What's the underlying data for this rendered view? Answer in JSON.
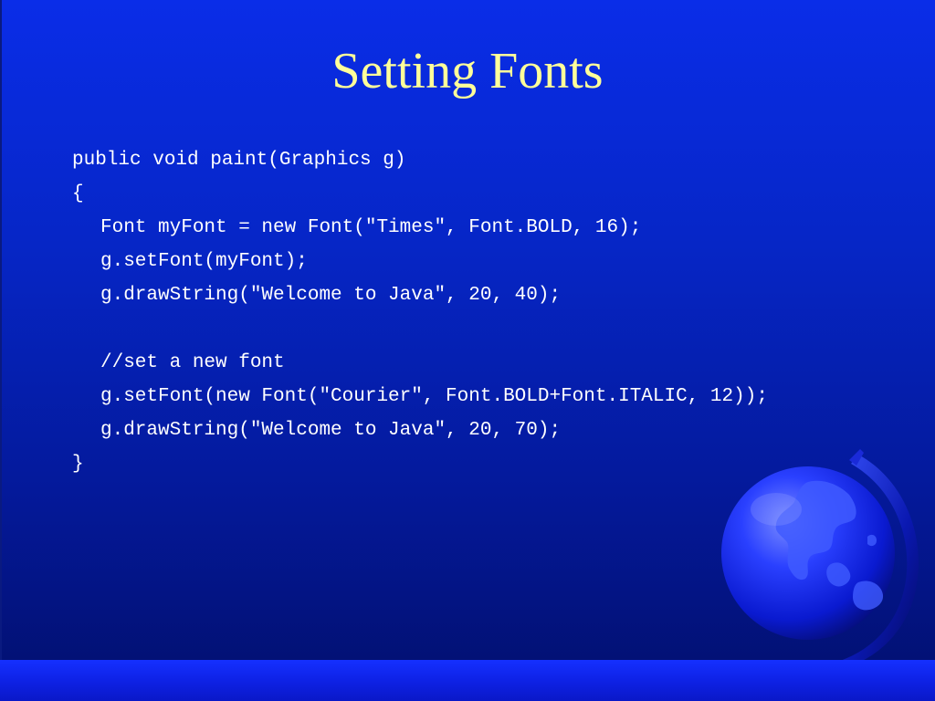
{
  "slide": {
    "title": "Setting Fonts",
    "code_lines": [
      "public void paint(Graphics g)",
      "{",
      "Font myFont = new Font(\"Times\", Font.BOLD, 16);",
      "g.setFont(myFont);",
      "g.drawString(\"Welcome to Java\", 20, 40);",
      "",
      "//set a new font",
      "g.setFont(new Font(\"Courier\", Font.BOLD+Font.ITALIC, 12));",
      "g.drawString(\"Welcome to Java\", 20, 70);",
      "}"
    ]
  },
  "colors": {
    "title": "#ffff99",
    "code_text": "#ffffff",
    "background": "#0626c6",
    "bottom_bar": "#1530ff"
  },
  "decorations": {
    "globe_icon": "globe-icon"
  }
}
